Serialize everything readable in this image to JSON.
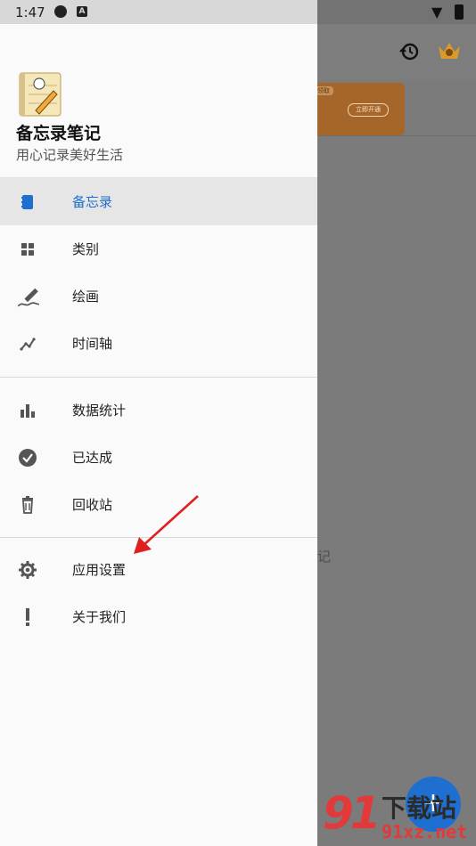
{
  "status_bar": {
    "time": "1:47",
    "icons": [
      "sync-icon",
      "a-badge-icon",
      "wifi-icon",
      "battery-icon"
    ],
    "badge_letter": "A"
  },
  "drawer": {
    "app_name": "备忘录笔记",
    "app_slogan": "用心记录美好生活",
    "menu_section_1": [
      {
        "label": "备忘录",
        "icon": "notebook-icon",
        "active": true
      },
      {
        "label": "类别",
        "icon": "grid-icon",
        "active": false
      },
      {
        "label": "绘画",
        "icon": "pen-draw-icon",
        "active": false
      },
      {
        "label": "时间轴",
        "icon": "timeline-icon",
        "active": false
      }
    ],
    "menu_section_2": [
      {
        "label": "数据统计",
        "icon": "bar-chart-icon"
      },
      {
        "label": "已达成",
        "icon": "check-circle-icon"
      },
      {
        "label": "回收站",
        "icon": "trash-icon"
      }
    ],
    "menu_section_3": [
      {
        "label": "应用设置",
        "icon": "gear-icon"
      },
      {
        "label": "关于我们",
        "icon": "exclamation-icon"
      }
    ]
  },
  "background_app": {
    "banner_tag": "领取",
    "banner_button": "立即开通",
    "partial_text": "记",
    "fab_label": "+"
  },
  "watermark": {
    "logo": "91",
    "title": "下载站",
    "url": "91xz.net"
  },
  "colors": {
    "accent": "#1f6fd0",
    "active_row": "#e6e6e6",
    "annotation_arrow": "#e02020",
    "watermark_red": "#e23a3a"
  }
}
